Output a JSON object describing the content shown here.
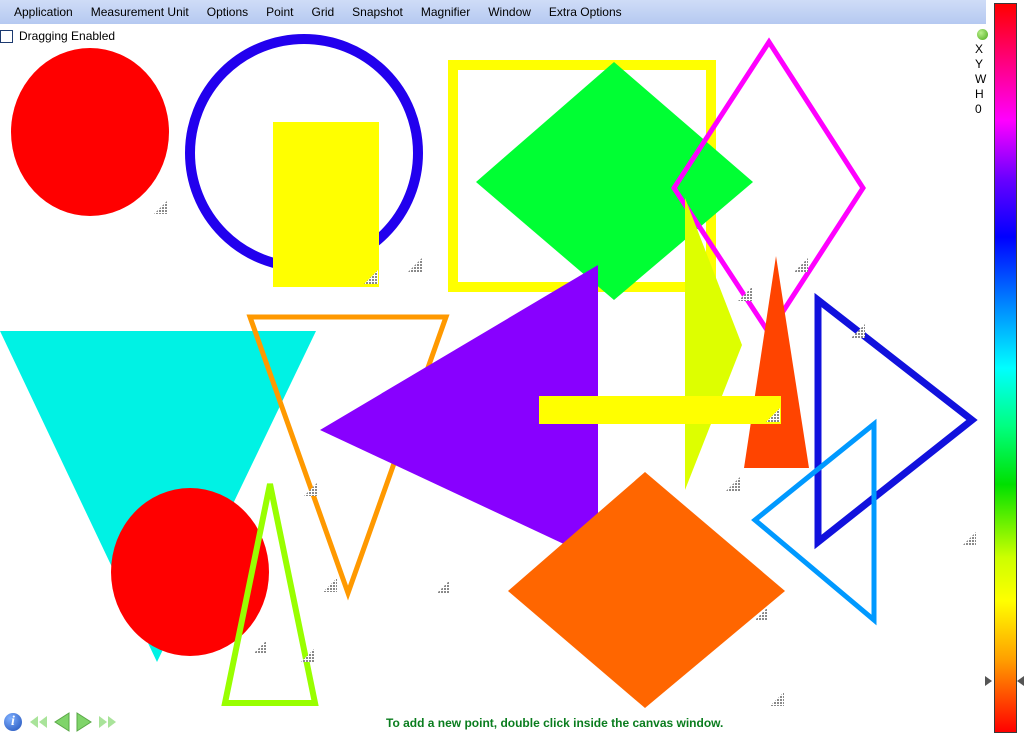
{
  "menubar": {
    "items": [
      "Application",
      "Measurement Unit",
      "Options",
      "Point",
      "Grid",
      "Snapshot",
      "Magnifier",
      "Window",
      "Extra Options"
    ]
  },
  "dragging": {
    "label": "Dragging Enabled",
    "checked": false
  },
  "info_panel": {
    "labels": [
      "X",
      "Y",
      "W",
      "H",
      "0"
    ]
  },
  "status": {
    "text": "To add a new point, double click inside the canvas window."
  },
  "colorbar": {
    "marker_value": 0.93
  },
  "icons": {
    "info": "info-icon",
    "first": "rewind-icon",
    "prev": "previous-icon",
    "next": "next-icon",
    "last": "fast-forward-icon",
    "resize": "resize-grip-icon",
    "status": "status-dot-icon"
  },
  "colors": {
    "red_circle": "#ff0000",
    "blue_ring": "#2200ee",
    "yellow": "#ffff00",
    "green_diamond": "#00ff33",
    "magenta_diamond": "#ff00ff",
    "cyan_triangle": "#00f2e4",
    "orange_triangle": "#ff9900",
    "purple_triangle": "#8800ff",
    "lime_triangle": "#ddff00",
    "orange_red_triangle": "#ff4400",
    "blue_triangle": "#1111dd",
    "light_blue_triangle": "#0099ff",
    "orange_diamond": "#ff6600",
    "green_outline_triangle": "#99ff00",
    "status_text": "#0a7d1e"
  }
}
